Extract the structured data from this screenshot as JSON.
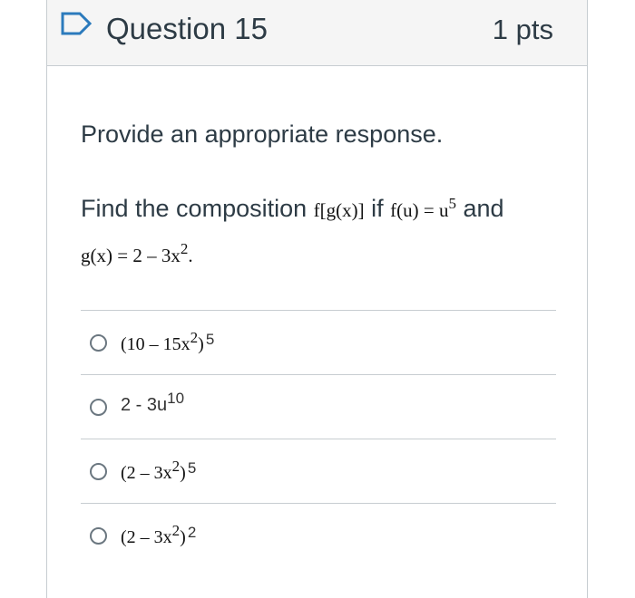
{
  "header": {
    "title": "Question 15",
    "points": "1 pts"
  },
  "prompt": "Provide an appropriate response.",
  "question": {
    "text_a": "Find the composition ",
    "expr_fg": "f[g(x)]",
    "text_b": " if ",
    "expr_f": "f(u) = u",
    "expr_f_exp": "5",
    "text_c": " and",
    "expr_g": "g(x) = 2 –  3x",
    "expr_g_exp": "2",
    "expr_g_end": "."
  },
  "answers": [
    {
      "base": "(10 – 15x",
      "inner_exp": "2",
      "close": ")",
      "outer_exp": "5"
    },
    {
      "base": "2 - 3u",
      "inner_exp": "10",
      "close": "",
      "outer_exp": ""
    },
    {
      "base": "(2 – 3x",
      "inner_exp": "2",
      "close": ")",
      "outer_exp": "5"
    },
    {
      "base": "(2 – 3x",
      "inner_exp": "2",
      "close": ")",
      "outer_exp": "2"
    }
  ]
}
